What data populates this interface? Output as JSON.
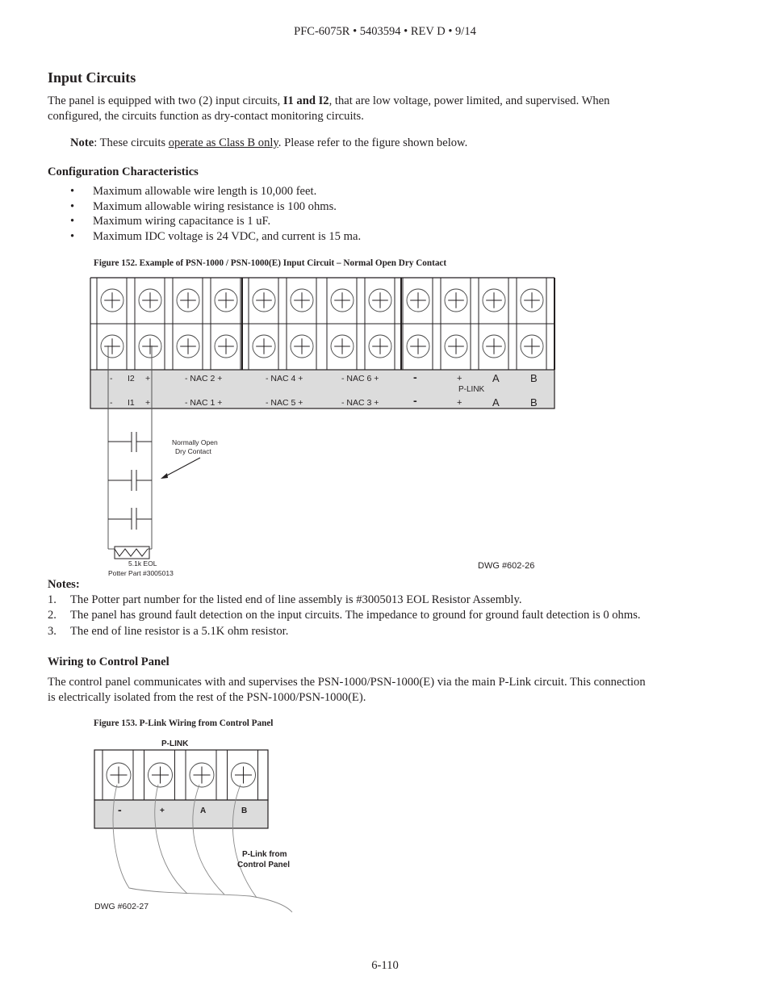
{
  "header": {
    "doc_id": "PFC-6075R • 5403594 • REV D • 9/14"
  },
  "section": {
    "title": "Input Circuits",
    "intro_before_bold": "The panel is equipped with two (2) input circuits, ",
    "intro_bold": "I1 and I2",
    "intro_after_bold_line1": ", that are low voltage, power limited, and supervised. When",
    "intro_line2": "configured, the circuits function as dry-contact monitoring circuits.",
    "note_label": "Note",
    "note_before_underline": ": These circuits ",
    "note_underlined": "operate as Class B only",
    "note_after": ". Please refer to the figure shown below."
  },
  "config": {
    "title": "Configuration Characteristics",
    "bullet_glyph": "•",
    "items": [
      "Maximum allowable wire length is 10,000 feet.",
      "Maximum allowable wiring resistance is 100 ohms.",
      "Maximum wiring capacitance is 1 uF.",
      "Maximum IDC voltage is 24 VDC, and current is 15 ma."
    ]
  },
  "figure152": {
    "caption": "Figure 152. Example of PSN-1000 / PSN-1000(E) Input Circuit – Normal Open Dry Contact",
    "top_row_labels": [
      "-",
      "I2",
      "+",
      "- NAC 2 +",
      "- NAC 4 +",
      "- NAC 6 +",
      "-",
      "+",
      "A",
      "B"
    ],
    "bottom_row_labels": [
      "-",
      "I1",
      "+",
      "- NAC 1 +",
      "- NAC 5 +",
      "- NAC 3 +",
      "-",
      "+",
      "A",
      "B"
    ],
    "plink_label": "P-LINK",
    "contact_label_line1": "Normally Open",
    "contact_label_line2": "Dry Contact",
    "eol_label": "5.1k EOL",
    "part_label": "Potter Part #3005013",
    "dwg": "DWG #602-26"
  },
  "notes": {
    "title": "Notes:",
    "items": [
      {
        "num": "1.",
        "text": "The Potter part number for the listed end of line assembly is #3005013 EOL Resistor Assembly."
      },
      {
        "num": "2.",
        "text": "The panel has ground fault detection on the input circuits. The impedance to ground for ground fault detection is 0 ohms."
      },
      {
        "num": "3.",
        "text": "The end of line resistor is a 5.1K ohm resistor."
      }
    ]
  },
  "wiring": {
    "title": "Wiring to Control Panel",
    "line1": "The control panel communicates with and supervises the PSN-1000/PSN-1000(E) via the main P-Link circuit.  This connection",
    "line2": "is electrically isolated from the rest of the PSN-1000/PSN-1000(E)."
  },
  "figure153": {
    "caption": "Figure 153. P-Link Wiring from Control Panel",
    "plink_title": "P-LINK",
    "terminal_labels": [
      "-",
      "+",
      "A",
      "B"
    ],
    "from_label_line1": "P-Link from",
    "from_label_line2": "Control Panel",
    "dwg": "DWG #602-27"
  },
  "footer": {
    "page": "6-110"
  }
}
